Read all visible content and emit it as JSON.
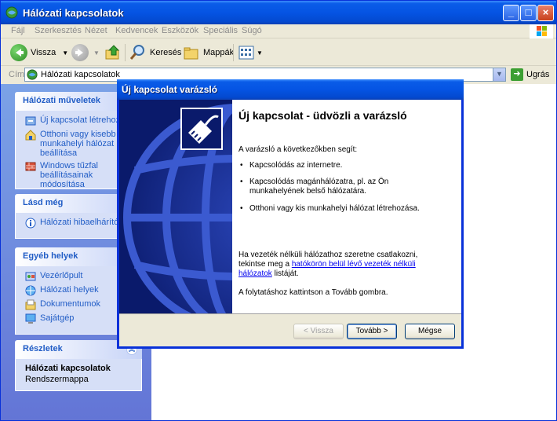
{
  "window": {
    "title": "Hálózati kapcsolatok"
  },
  "menu": [
    "Fájl",
    "Szerkesztés",
    "Nézet",
    "Kedvencek",
    "Eszközök",
    "Speciális",
    "Súgó"
  ],
  "toolbar": {
    "back": "Vissza",
    "search": "Keresés",
    "folders": "Mappák"
  },
  "address": {
    "label": "Cím",
    "value": "Hálózati kapcsolatok",
    "go": "Ugrás"
  },
  "sidebar": {
    "network_tasks": {
      "title": "Hálózati műveletek",
      "items": [
        "Új kapcsolat létrehozása",
        "Otthoni vagy kisebb munkahelyi hálózat beállítása",
        "Windows tűzfal beállításainak módosítása"
      ]
    },
    "see_also": {
      "title": "Lásd még",
      "items": [
        "Hálózati hibaelhárító"
      ]
    },
    "other_places": {
      "title": "Egyéb helyek",
      "items": [
        "Vezérlőpult",
        "Hálózati helyek",
        "Dokumentumok",
        "Sajátgép"
      ]
    },
    "details": {
      "title": "Részletek",
      "name": "Hálózati kapcsolatok",
      "type": "Rendszermappa"
    }
  },
  "wizard": {
    "title": "Új kapcsolat varázsló",
    "heading": "Új kapcsolat - üdvözli a varázsló",
    "intro": "A varázsló a következőkben segít:",
    "bullets": [
      "Kapcsolódás az internetre.",
      "Kapcsolódás magánhálózatra, pl. az Ön munkahelyének belső hálózatára.",
      "Otthoni vagy kis munkahelyi hálózat létrehozása."
    ],
    "wireless_pre": "Ha vezeték nélküli hálózathoz szeretne csatlakozni, tekintse meg a ",
    "wireless_link": "hatókörön belül lévő vezeték nélküli hálózatok",
    "wireless_post": " listáját.",
    "continue": "A folytatáshoz kattintson a Tovább gombra.",
    "back_btn": "< Vissza",
    "next_btn": "Tovább >",
    "cancel_btn": "Mégse"
  }
}
